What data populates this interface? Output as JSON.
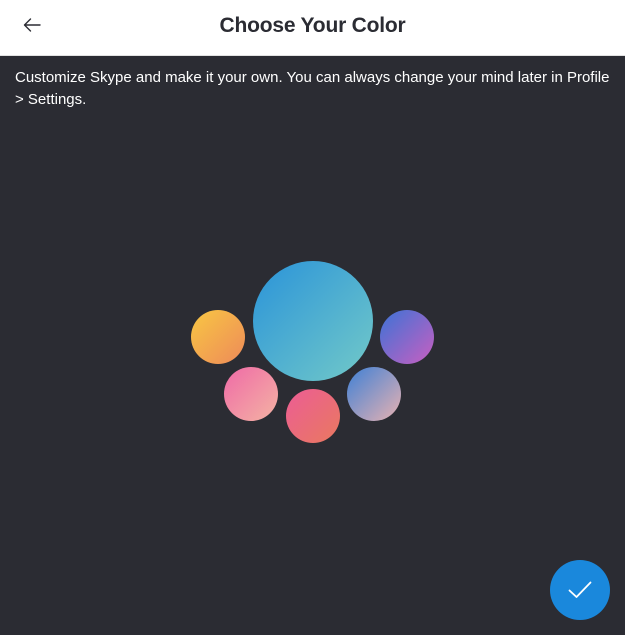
{
  "header": {
    "title": "Choose Your Color",
    "back_icon": "arrow-left-icon"
  },
  "description": "Customize Skype and make it your own. You can always change your mind later in Profile > Settings.",
  "colors": {
    "header_bg": "#ffffff",
    "page_bg": "#2b2c33",
    "title_text": "#2b2c33",
    "body_text": "#ffffff",
    "confirm_button": "#1a88dc"
  },
  "swatches": [
    {
      "id": "blue-teal",
      "selected": true,
      "gradient": [
        "#2a93d9",
        "#73cac8"
      ]
    },
    {
      "id": "yellow-orange",
      "selected": false,
      "gradient": [
        "#f8c743",
        "#ee8a59"
      ]
    },
    {
      "id": "blue-purple",
      "selected": false,
      "gradient": [
        "#3c73d6",
        "#c95fc1"
      ]
    },
    {
      "id": "pink-peach",
      "selected": false,
      "gradient": [
        "#ef6aa6",
        "#f4b3a4"
      ]
    },
    {
      "id": "pink-coral",
      "selected": false,
      "gradient": [
        "#ec5d95",
        "#e9795f"
      ]
    },
    {
      "id": "blue-rose",
      "selected": false,
      "gradient": [
        "#3f80d5",
        "#e8b2b2"
      ]
    }
  ],
  "confirm": {
    "icon": "checkmark-icon"
  }
}
